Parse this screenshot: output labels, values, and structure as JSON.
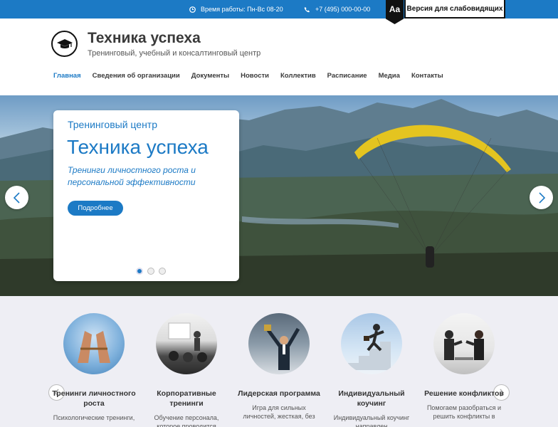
{
  "topbar": {
    "hours": "Время работы: Пн-Вс 08-20",
    "phone": "+7 (495) 000-00-00",
    "aa": "Aa",
    "vision_label": "Версия для слабовидящих"
  },
  "header": {
    "title": "Техника успеха",
    "subtitle": "Тренинговый, учебный и консалтинговый центр"
  },
  "nav": {
    "items": [
      "Главная",
      "Сведения об организации",
      "Документы",
      "Новости",
      "Коллектив",
      "Расписание",
      "Медиа",
      "Контакты"
    ]
  },
  "slider": {
    "kicker": "Тренинговый центр",
    "title": "Техника успеха",
    "description": "Тренинги личностного роста и персональной эффективности",
    "button": "Подробнее"
  },
  "services": [
    {
      "name": "Тренинги личностного роста",
      "text": "Психологические тренинги,"
    },
    {
      "name": "Корпоративные тренинги",
      "text": "Обучение персонала, которое проводится"
    },
    {
      "name": "Лидерская программа",
      "text": "Игра для сильных личностей, жесткая, без"
    },
    {
      "name": "Индивидуальный коучинг",
      "text": "Индивидуальный коучинг направлен"
    },
    {
      "name": "Решение конфликтов",
      "text": "Помогаем разобраться и решить конфликты в"
    }
  ],
  "colors": {
    "accent": "#1c7ac5",
    "topbar": "#1c7ac5",
    "services_bg": "#eeeef4"
  }
}
